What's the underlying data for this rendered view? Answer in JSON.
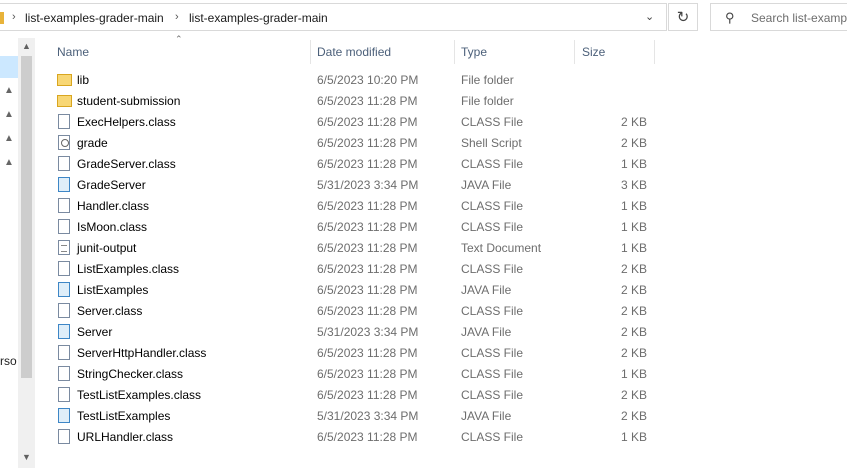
{
  "address_bar": {
    "breadcrumbs": [
      "list-examples-grader-main",
      "list-examples-grader-main"
    ],
    "separator": "›",
    "dropdown_icon": "chevron-down-icon",
    "refresh_icon": "refresh-icon"
  },
  "search": {
    "placeholder": "Search list-exampl",
    "icon": "search-icon"
  },
  "nav_pane": {
    "partial_label": "rso",
    "pin_icon": "pin-icon"
  },
  "columns": {
    "name": "Name",
    "date": "Date modified",
    "type": "Type",
    "size": "Size"
  },
  "files": [
    {
      "name": "lib",
      "date": "6/5/2023 10:20 PM",
      "type": "File folder",
      "size": "",
      "icon": "folder"
    },
    {
      "name": "student-submission",
      "date": "6/5/2023 11:28 PM",
      "type": "File folder",
      "size": "",
      "icon": "folder"
    },
    {
      "name": "ExecHelpers.class",
      "date": "6/5/2023 11:28 PM",
      "type": "CLASS File",
      "size": "2 KB",
      "icon": "class"
    },
    {
      "name": "grade",
      "date": "6/5/2023 11:28 PM",
      "type": "Shell Script",
      "size": "2 KB",
      "icon": "script"
    },
    {
      "name": "GradeServer.class",
      "date": "6/5/2023 11:28 PM",
      "type": "CLASS File",
      "size": "1 KB",
      "icon": "class"
    },
    {
      "name": "GradeServer",
      "date": "5/31/2023 3:34 PM",
      "type": "JAVA File",
      "size": "3 KB",
      "icon": "java"
    },
    {
      "name": "Handler.class",
      "date": "6/5/2023 11:28 PM",
      "type": "CLASS File",
      "size": "1 KB",
      "icon": "class"
    },
    {
      "name": "IsMoon.class",
      "date": "6/5/2023 11:28 PM",
      "type": "CLASS File",
      "size": "1 KB",
      "icon": "class"
    },
    {
      "name": "junit-output",
      "date": "6/5/2023 11:28 PM",
      "type": "Text Document",
      "size": "1 KB",
      "icon": "text"
    },
    {
      "name": "ListExamples.class",
      "date": "6/5/2023 11:28 PM",
      "type": "CLASS File",
      "size": "2 KB",
      "icon": "class"
    },
    {
      "name": "ListExamples",
      "date": "6/5/2023 11:28 PM",
      "type": "JAVA File",
      "size": "2 KB",
      "icon": "java"
    },
    {
      "name": "Server.class",
      "date": "6/5/2023 11:28 PM",
      "type": "CLASS File",
      "size": "2 KB",
      "icon": "class"
    },
    {
      "name": "Server",
      "date": "5/31/2023 3:34 PM",
      "type": "JAVA File",
      "size": "2 KB",
      "icon": "java"
    },
    {
      "name": "ServerHttpHandler.class",
      "date": "6/5/2023 11:28 PM",
      "type": "CLASS File",
      "size": "2 KB",
      "icon": "class"
    },
    {
      "name": "StringChecker.class",
      "date": "6/5/2023 11:28 PM",
      "type": "CLASS File",
      "size": "1 KB",
      "icon": "class"
    },
    {
      "name": "TestListExamples.class",
      "date": "6/5/2023 11:28 PM",
      "type": "CLASS File",
      "size": "2 KB",
      "icon": "class"
    },
    {
      "name": "TestListExamples",
      "date": "5/31/2023 3:34 PM",
      "type": "JAVA File",
      "size": "2 KB",
      "icon": "java"
    },
    {
      "name": "URLHandler.class",
      "date": "6/5/2023 11:28 PM",
      "type": "CLASS File",
      "size": "1 KB",
      "icon": "class"
    }
  ]
}
